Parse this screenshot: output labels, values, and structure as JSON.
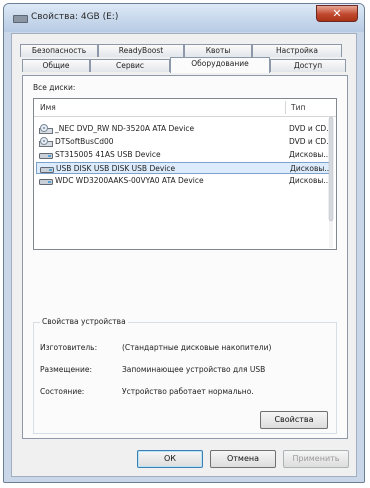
{
  "window": {
    "title": "Свойства: 4GB (E:)",
    "close_glyph": "✕",
    "tabs_row1": [
      "Безопасность",
      "ReadyBoost",
      "Квоты",
      "Настройка"
    ],
    "tabs_row2": [
      "Общие",
      "Сервис",
      "Оборудование",
      "Доступ"
    ],
    "active_tab": "Оборудование"
  },
  "devices": {
    "label": "Все диски:",
    "columns": [
      "Имя",
      "Тип"
    ],
    "rows": [
      {
        "name": "_NEC DVD_RW ND-3520A ATA Device",
        "type": "DVD и CD...",
        "icon": "cd-drive-icon"
      },
      {
        "name": "DTSoftBusCd00",
        "type": "DVD и CD...",
        "icon": "cd-drive-icon"
      },
      {
        "name": "ST315005 41AS USB Device",
        "type": "Дисковы...",
        "icon": "disk-drive-icon"
      },
      {
        "name": "USB DISK USB DISK USB Device",
        "type": "Дисковы...",
        "icon": "disk-drive-icon",
        "selected": true
      },
      {
        "name": "WDC WD3200AAKS-00VYA0 ATA Device",
        "type": "Дисковы...",
        "icon": "disk-drive-icon"
      }
    ]
  },
  "properties": {
    "group_title": "Свойства устройства",
    "manufacturer_label": "Изготовитель:",
    "manufacturer_value": "(Стандартные дисковые накопители)",
    "location_label": "Размещение:",
    "location_value": "Запоминающее устройство для USB",
    "status_label": "Состояние:",
    "status_value": "Устройство работает нормально.",
    "properties_button": "Свойства"
  },
  "footer": {
    "ok": "ОК",
    "cancel": "Отмена",
    "apply": "Применить"
  },
  "colors": {
    "selection": "#ddecfd",
    "close_button": "#c0482e",
    "frame": "#c9d7e8"
  }
}
